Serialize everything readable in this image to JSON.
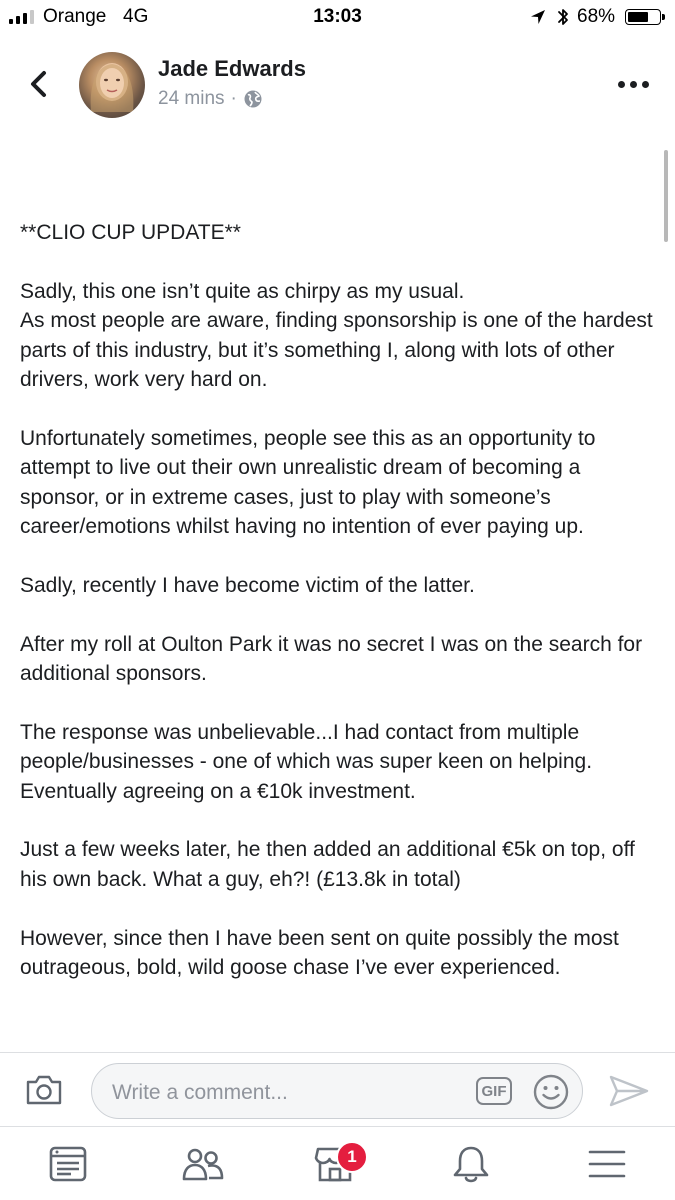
{
  "status_bar": {
    "carrier": "Orange",
    "network": "4G",
    "time": "13:03",
    "battery": "68%",
    "battery_level": 0.68
  },
  "post": {
    "author": "Jade Edwards",
    "time_ago": "24 mins",
    "separator": "·",
    "privacy_icon": "globe-icon",
    "paragraphs": [
      "**CLIO CUP UPDATE**",
      "Sadly, this one isn’t quite as chirpy as my usual.\nAs most people are aware, finding sponsorship is one of the hardest parts of this industry, but it’s something I, along with lots of other drivers, work very hard on.",
      "Unfortunately sometimes, people see this as an opportunity to attempt to live out their own unrealistic dream of becoming a sponsor, or in extreme cases, just to play with someone’s career/emotions whilst having no intention of ever paying up.",
      "Sadly, recently I have become victim of the latter.",
      "After my roll at Oulton Park it was no secret I was on the search for additional sponsors.",
      "The response was unbelievable...I had contact from multiple people/businesses - one of which was super keen on helping. Eventually agreeing on a €10k investment.",
      "Just a few weeks later, he then added an additional €5k on top, off his own back. What a guy, eh?! (£13.8k in total)",
      "However, since then I have been sent on quite possibly the most outrageous, bold, wild goose chase I’ve ever experienced."
    ]
  },
  "comment_bar": {
    "placeholder": "Write a comment...",
    "gif_label": "GIF"
  },
  "tab_bar": {
    "tabs": [
      "news-feed-icon",
      "friends-icon",
      "marketplace-icon",
      "notifications-icon",
      "menu-icon"
    ],
    "marketplace_badge": "1"
  },
  "colors": {
    "text": "#1c1e21",
    "meta": "#8d949e",
    "badge": "#e41e3f",
    "icon_gray": "#7f8389"
  }
}
